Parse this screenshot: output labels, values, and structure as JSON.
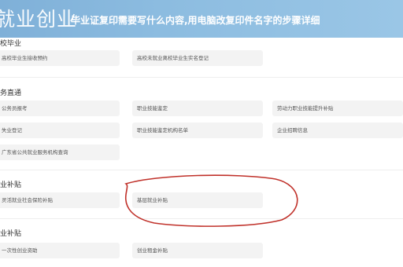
{
  "header": {
    "logo_text": "就业创业",
    "headline": "毕业证复印需要写什么内容,用电脑改复印件名字的步骤详细"
  },
  "sections": [
    {
      "title": "校毕业",
      "items": [
        "高校毕业生接收预约",
        "高校未就业离校毕业生实名登记"
      ]
    },
    {
      "title": "务直通",
      "items": [
        "公务员报考",
        "职业技能鉴定",
        "劳动力职业技能提升补贴",
        "失业登记",
        "职业技能鉴定机构名单",
        "企业招聘信息",
        "广东省公共就业服务机构查询"
      ]
    },
    {
      "title": "业补贴",
      "items": [
        "灵活就业社会保险补贴",
        "基层就业补贴"
      ]
    },
    {
      "title": "业补贴",
      "items": [
        "一次性创业资助",
        "创业租金补贴"
      ]
    }
  ],
  "colors": {
    "header_gradient_start": "#7fb0d8",
    "header_gradient_end": "#9ac6e6",
    "card_bg": "#f3f3f3",
    "annotation_red": "#c0312a"
  }
}
